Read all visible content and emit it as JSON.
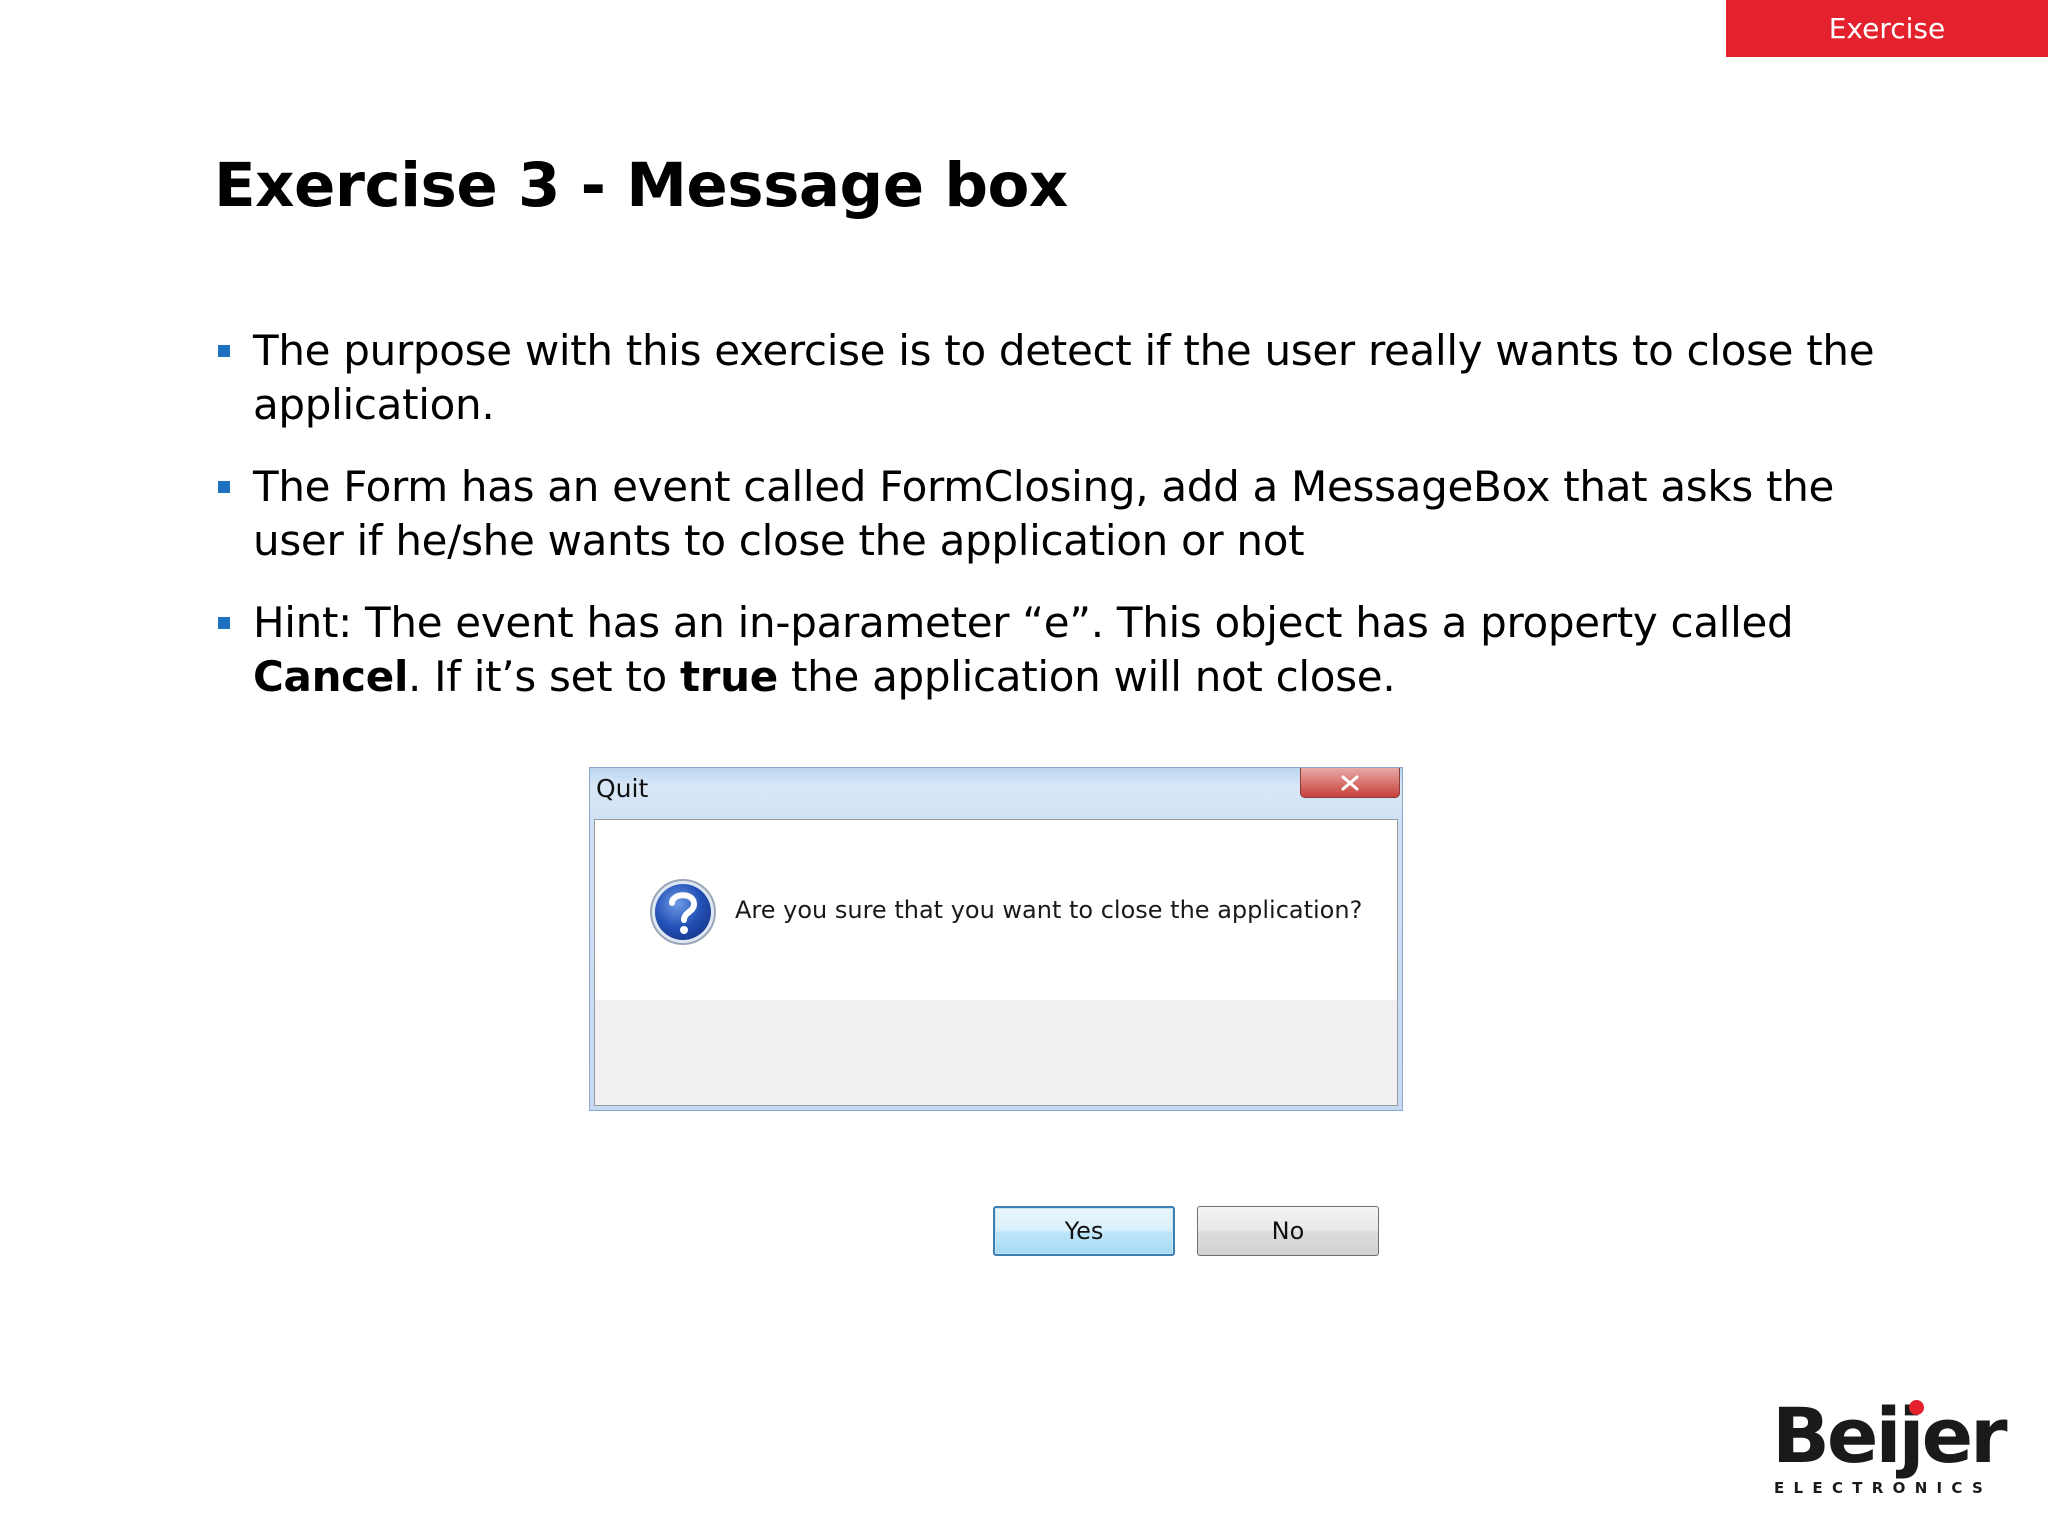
{
  "header": {
    "tag_label": "Exercise",
    "tag_color": "#e4222e"
  },
  "slide": {
    "title": "Exercise 3 - Message box",
    "bullets": [
      {
        "text": "The purpose with this exercise is to detect if the user really wants to close the application."
      },
      {
        "text": "The Form has an event called FormClosing, add a MessageBox that asks the user if he/she wants to close the application or not"
      },
      {
        "part1": "Hint: The event has an in-parameter “e”. This object has a property called ",
        "bold1": "Cancel",
        "part2": ". If it’s set to ",
        "bold2": "true",
        "part3": " the application will not close."
      }
    ],
    "bullet_color": "#1f6fc0"
  },
  "dialog": {
    "title": "Quit",
    "close_icon": "close-icon",
    "message_icon": "question-icon",
    "message": "Are you sure that you want to close the application?",
    "yes_label": "Yes",
    "no_label": "No"
  },
  "logo": {
    "wordmark": "Beijer",
    "subtitle": "ELECTRONICS"
  }
}
